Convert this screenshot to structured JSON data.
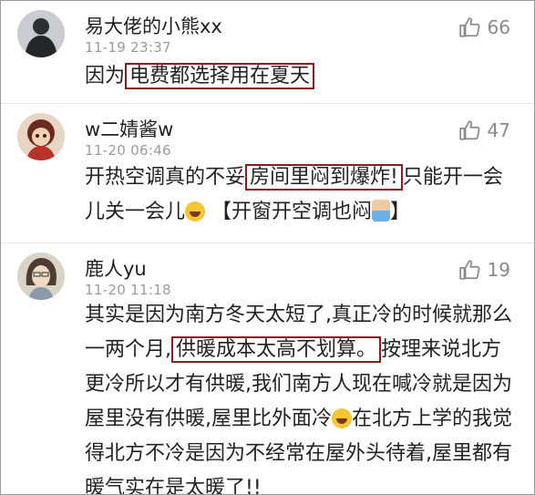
{
  "comments": [
    {
      "username": "易大佬的小熊xx",
      "time": "11-19 23:37",
      "likes": "66",
      "avatar_icon": "dark-silhouette-avatar",
      "text": {
        "before": "因为",
        "highlight": "电费都选择用在夏天",
        "after": ""
      }
    },
    {
      "username": "w二婧酱w",
      "time": "11-20 06:46",
      "likes": "47",
      "avatar_icon": "doll-avatar",
      "text": {
        "before": "开热空调真的不妥",
        "highlight": "房间里闷到爆炸!",
        "middle": "只能开一会儿关一会儿",
        "after": "【开窗开空调也闷"
      }
    },
    {
      "username": "鹿人yu",
      "time": "11-20 11:18",
      "likes": "19",
      "avatar_icon": "girl-avatar",
      "text": {
        "before": "其实是因为南方冬天太短了,真正冷的时候就那么一两个月,",
        "highlight": "供暖成本太高不划算。",
        "middle": "按理来说北方更冷所以才有供暖,我们南方人现在喊冷就是因为屋里没有供暖,屋里比外面冷",
        "after": "在北方上学的我觉得北方不冷是因为不经常在屋外头待着,屋里都有暖气实在是太暖了!!"
      }
    }
  ],
  "colors": {
    "highlight_border": "#8b1d22",
    "meta_text": "#9b9b9b"
  }
}
